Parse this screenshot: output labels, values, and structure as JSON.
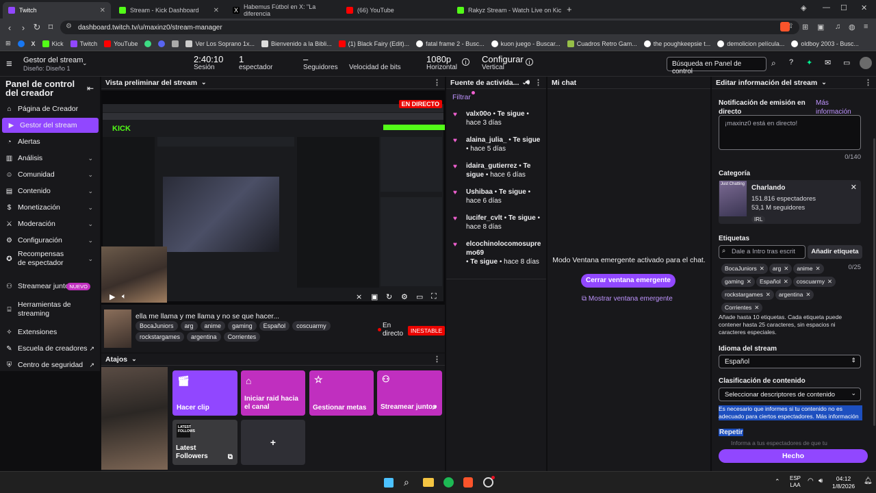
{
  "browser": {
    "tabs": [
      {
        "label": "Twitch",
        "color": "#9147ff"
      },
      {
        "label": "Stream - Kick Dashboard",
        "color": "#53fc18"
      },
      {
        "label": "Habemus Fútbol en X: \"La diferencia",
        "color": "#ffffff"
      },
      {
        "label": "(66) YouTube",
        "color": "#ff0000"
      },
      {
        "label": "Rakyz Stream - Watch Live on Kic",
        "color": "#53fc18"
      }
    ],
    "url": "dashboard.twitch.tv/u/maxinz0/stream-manager",
    "bookmarks": [
      {
        "label": "",
        "color": "#1877f2"
      },
      {
        "label": "",
        "color": "#ffffff"
      },
      {
        "label": "Kick",
        "color": "#53fc18"
      },
      {
        "label": "Twitch",
        "color": "#9147ff"
      },
      {
        "label": "YouTube",
        "color": "#ff0000"
      },
      {
        "label": "",
        "color": "#3ddc84"
      },
      {
        "label": "",
        "color": "#5865f2"
      },
      {
        "label": "",
        "color": "#aaaaaa"
      },
      {
        "label": "Ver Los Soprano 1x...",
        "color": "#cccccc"
      },
      {
        "label": "Bienvenido a la Bibli...",
        "color": "#dddddd"
      },
      {
        "label": "(1) Black Fairy (Edit)...",
        "color": "#ff0000"
      },
      {
        "label": "fatal frame 2 - Busc...",
        "color": "#ffffff"
      },
      {
        "label": "kuon juego - Buscar...",
        "color": "#ffffff"
      },
      {
        "label": "Cuadros Retro Gam...",
        "color": "#96bf48"
      },
      {
        "label": "the poughkeepsie t...",
        "color": "#ffffff"
      },
      {
        "label": "demolicion película...",
        "color": "#ffffff"
      },
      {
        "label": "oldboy 2003 - Busc...",
        "color": "#ffffff"
      }
    ]
  },
  "topbar": {
    "manager_title": "Gestor del stream",
    "layout": "Diseño: Diseño 1",
    "session_value": "2:40:10",
    "session_label": "Sesión",
    "viewers_value": "1",
    "viewers_label": "espectador",
    "followers_value": "–",
    "followers_label": "Seguidores",
    "bitrate_label": "Velocidad de bits",
    "quality_value": "1080p",
    "quality_label": "Horizontal",
    "config_value": "Configurar",
    "config_label": "Vertical",
    "search_placeholder": "Búsqueda en Panel de control"
  },
  "sidebar": {
    "title": "Panel de control del creador",
    "items": [
      {
        "label": "Página de Creador",
        "icon": "home-icon",
        "chev": false
      },
      {
        "label": "Gestor del stream",
        "icon": "stream-icon",
        "chev": false
      },
      {
        "label": "Alertas",
        "icon": "alert-icon",
        "chev": false
      },
      {
        "label": "Análisis",
        "icon": "chart-icon",
        "chev": true
      },
      {
        "label": "Comunidad",
        "icon": "community-icon",
        "chev": true
      },
      {
        "label": "Contenido",
        "icon": "content-icon",
        "chev": true
      },
      {
        "label": "Monetización",
        "icon": "money-icon",
        "chev": true
      },
      {
        "label": "Moderación",
        "icon": "sword-icon",
        "chev": true
      },
      {
        "label": "Configuración",
        "icon": "gear-icon",
        "chev": true
      },
      {
        "label": "Recompensas de espectador",
        "icon": "reward-icon",
        "chev": true
      },
      {
        "label": "Streamear juntos",
        "icon": "together-icon",
        "chev": false,
        "badge": "NUEVO"
      },
      {
        "label": "Herramientas de streaming",
        "icon": "tools-icon",
        "chev": false
      },
      {
        "label": "Extensiones",
        "icon": "extension-icon",
        "chev": false
      },
      {
        "label": "Escuela de creadores",
        "icon": "school-icon",
        "chev": false
      },
      {
        "label": "Centro de seguridad",
        "icon": "shield-icon",
        "chev": false
      }
    ]
  },
  "preview": {
    "header": "Vista preliminar del stream",
    "live_badge": "EN DIRECTO",
    "stream_title": "ella me llama y me llama y no se que hacer...",
    "tags": [
      "BocaJuniors",
      "arg",
      "anime",
      "gaming",
      "Español",
      "coscuarmy",
      "rockstargames",
      "argentina",
      "Corrientes"
    ],
    "live_state": "En directo",
    "stability": "INESTABLE"
  },
  "shortcuts": {
    "header": "Atajos",
    "items": [
      {
        "label": "Hacer clip",
        "color": "#9147ff"
      },
      {
        "label": "Iniciar raid hacia el canal",
        "color": "#c02fbf"
      },
      {
        "label": "Gestionar metas",
        "color": "#c02fbf"
      },
      {
        "label": "Streamear juntos",
        "color": "#c02fbf"
      }
    ],
    "latest_label": "Latest Followers",
    "latest_icon_text": "LATEST FOLLOWS",
    "add": "+"
  },
  "activity": {
    "header": "Fuente de activida...",
    "filter": "Filtrar",
    "items": [
      {
        "name": "valx00o",
        "action": "Te sigue",
        "time": "hace 3 días"
      },
      {
        "name": "alaina_julia_",
        "action": "Te sigue",
        "time": "hace 5 días"
      },
      {
        "name": "idaira_gutierrez",
        "action": "Te sigue",
        "time": "hace 6 días"
      },
      {
        "name": "Ushibaa",
        "action": "Te sigue",
        "time": "hace 6 días"
      },
      {
        "name": "lucifer_cvlt",
        "action": "Te sigue",
        "time": "hace 8 días"
      },
      {
        "name": "elcochinolocomosupremo69",
        "action": "Te sigue",
        "time": "hace 8 días"
      }
    ]
  },
  "chat": {
    "header": "Mi chat",
    "message": "Modo Ventana emergente activado para el chat.",
    "close_button": "Cerrar ventana emergente",
    "show_link": "Mostrar ventana emergente"
  },
  "edit": {
    "header": "Editar información del stream",
    "notification_label": "Notificación de emisión en directo",
    "more_info": "Más información",
    "notification_text": "¡maxinz0 está en directo!",
    "char_count": "0/140",
    "category_label": "Categoría",
    "category_name": "Charlando",
    "category_viewers": "151.816 espectadores",
    "category_followers": "53,1 M seguidores",
    "category_tag": "IRL",
    "category_thumb_text": "Just Chatting",
    "tags_label": "Etiquetas",
    "tags_placeholder": "Dale a Intro tras escrit",
    "add_tag": "Añadir etiqueta",
    "tag_count": "0/25",
    "tags": [
      "BocaJuniors",
      "arg",
      "anime",
      "gaming",
      "Español",
      "coscuarmy",
      "rockstargames",
      "argentina",
      "Corrientes"
    ],
    "tags_help": "Añade hasta 10 etiquetas. Cada etiqueta puede contener hasta 25 caracteres, sin espacios ni caracteres especiales.",
    "language_label": "Idioma del stream",
    "language_value": "Español",
    "rating_label": "Clasificación de contenido",
    "rating_select": "Seleccionar descriptores de contenido",
    "rating_help": "Es necesario que informes si tu contenido no es adecuado para ciertos espectadores. Más información",
    "repeat_label": "Repetir",
    "repeat_help": "Informa a tus espectadores de que tu",
    "done": "Hecho"
  },
  "taskbar": {
    "lang": "ESP",
    "lang2": "LAA",
    "time": "04:12",
    "date": "1/8/2026"
  },
  "colors": {
    "accent": "#9147ff",
    "live": "#eb0400",
    "magenta": "#c02fbf"
  }
}
